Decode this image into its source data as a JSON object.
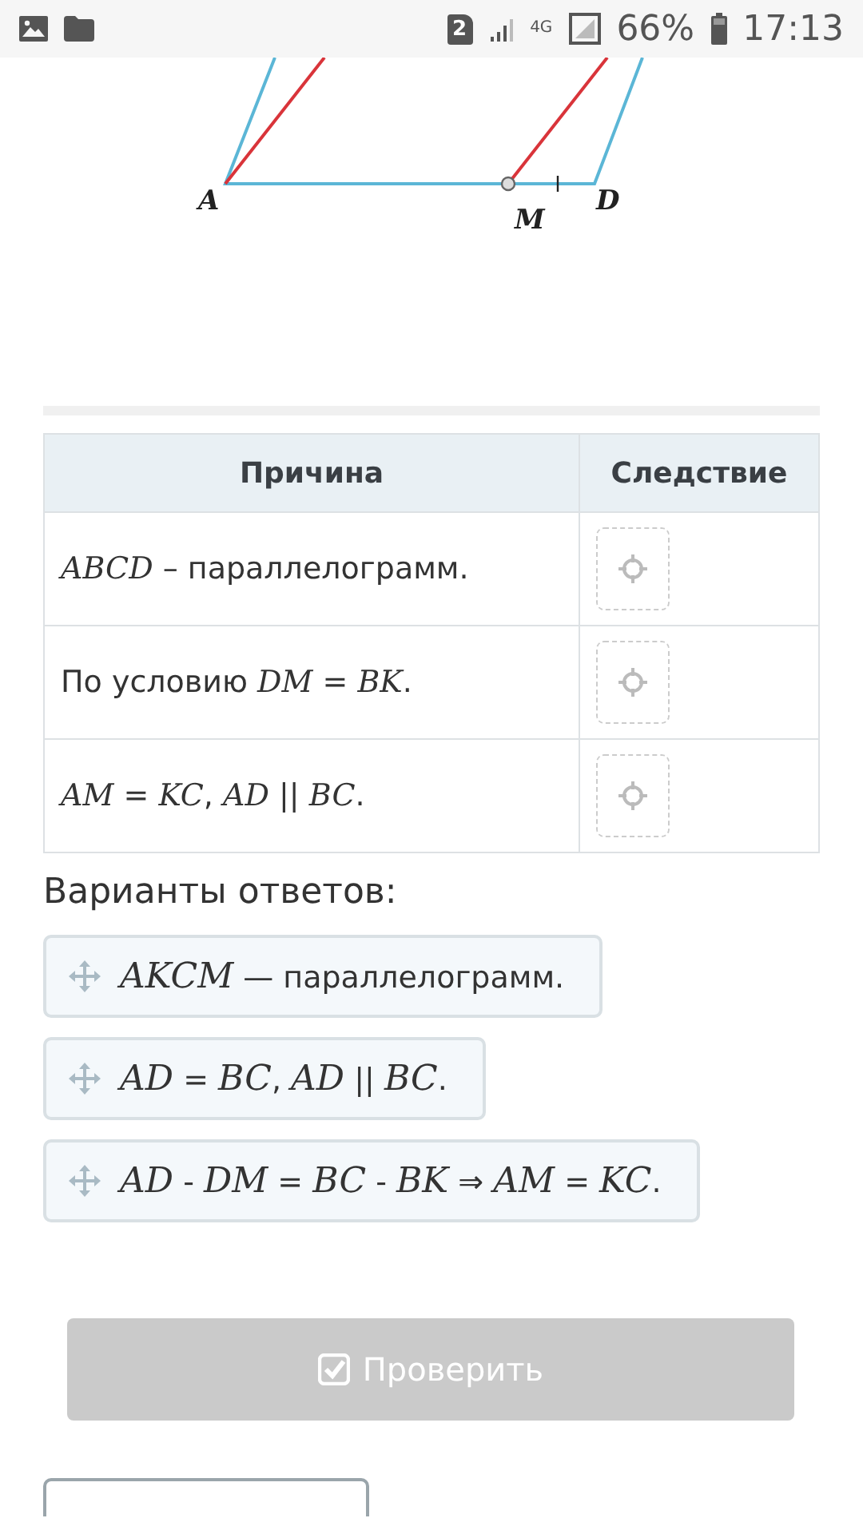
{
  "status_bar": {
    "sim_badge": "2",
    "network": "4G",
    "battery": "66%",
    "time": "17:13"
  },
  "figure": {
    "labels": [
      {
        "text": "A"
      },
      {
        "text": "M"
      },
      {
        "text": "D"
      }
    ]
  },
  "table": {
    "columns": [
      "Причина",
      "Следствие"
    ],
    "rows": [
      {
        "reason": "*ABCD* – параллелограмм."
      },
      {
        "reason": "По условию *DM* = *BK*."
      },
      {
        "reason": "*AM* = *KC*, *AD* || *BC*."
      }
    ]
  },
  "answers_heading": "Варианты ответов:",
  "answers": [
    {
      "text": "*AKCM* — параллелограмм."
    },
    {
      "text": "*AD* = *BC*, *AD* || *BC*."
    },
    {
      "text": "*AD* - *DM* = *BC* - *BK* ⇒ *AM* = *KC*."
    }
  ],
  "check_button": {
    "label": "Проверить",
    "disabled": true
  }
}
